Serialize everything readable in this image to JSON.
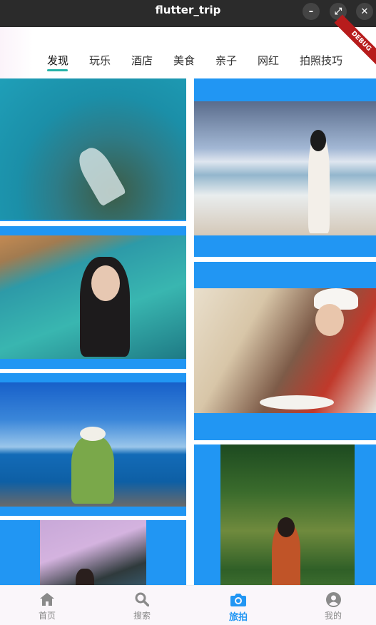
{
  "window": {
    "title": "flutter_trip",
    "minimize_glyph": "–",
    "maximize_glyph": "⤢",
    "close_glyph": "✕"
  },
  "debug_banner": "DEBUG",
  "tabs": [
    {
      "label": "发现",
      "active": true
    },
    {
      "label": "玩乐",
      "active": false
    },
    {
      "label": "酒店",
      "active": false
    },
    {
      "label": "美食",
      "active": false
    },
    {
      "label": "亲子",
      "active": false
    },
    {
      "label": "网红",
      "active": false
    },
    {
      "label": "拍照技巧",
      "active": false
    }
  ],
  "colors": {
    "accent": "#2196f3",
    "tab_indicator": "#26b3a8",
    "titlebar": "#2b2b2b"
  },
  "feed": {
    "photos": [
      {
        "subject": "underwater swimmer in mermaid tail",
        "column": "left"
      },
      {
        "subject": "woman in white dress on beach",
        "column": "right"
      },
      {
        "subject": "woman in hot spring pool",
        "column": "left"
      },
      {
        "subject": "woman eating with chef hat",
        "column": "right"
      },
      {
        "subject": "woman with hat sitting by the sea",
        "column": "left"
      },
      {
        "subject": "woman in forest",
        "column": "right"
      },
      {
        "subject": "woman under pink blossoms",
        "column": "left"
      }
    ]
  },
  "bottom_nav": [
    {
      "label": "首页",
      "icon": "home-icon",
      "active": false
    },
    {
      "label": "搜索",
      "icon": "search-icon",
      "active": false
    },
    {
      "label": "旅拍",
      "icon": "camera-icon",
      "active": true
    },
    {
      "label": "我的",
      "icon": "account-icon",
      "active": false
    }
  ]
}
